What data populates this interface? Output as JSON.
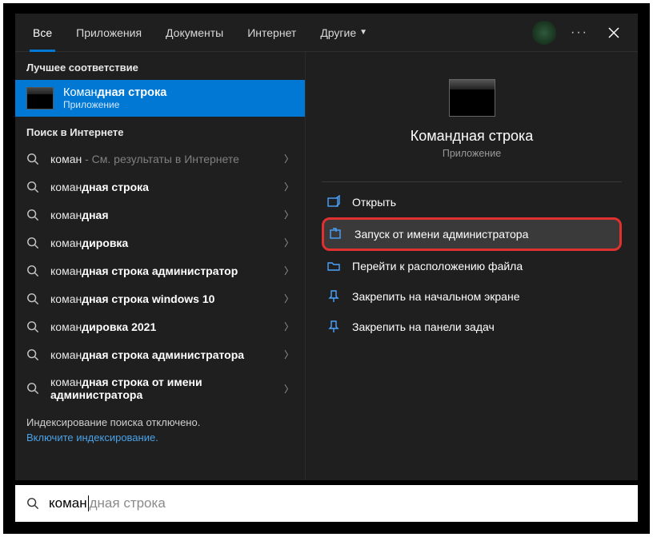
{
  "tabs": {
    "all": "Все",
    "apps": "Приложения",
    "documents": "Документы",
    "internet": "Интернет",
    "other": "Другие"
  },
  "sections": {
    "bestMatch": "Лучшее соответствие",
    "webSearch": "Поиск в Интернете"
  },
  "selected": {
    "prefix": "Коман",
    "bold": "дная строка",
    "subtitle": "Приложение"
  },
  "suggestions": [
    {
      "pre": "коман",
      "gray": " - См. результаты в Интернете",
      "bold": ""
    },
    {
      "pre": "коман",
      "bold": "дная строка"
    },
    {
      "pre": "коман",
      "bold": "дная"
    },
    {
      "pre": "коман",
      "bold": "дировка"
    },
    {
      "pre": "коман",
      "bold": "дная строка администратор"
    },
    {
      "pre": "коман",
      "bold": "дная строка windows 10"
    },
    {
      "pre": "коман",
      "bold": "дировка 2021"
    },
    {
      "pre": "коман",
      "bold": "дная строка администратора"
    },
    {
      "pre": "коман",
      "bold": "дная строка от имени администратора"
    }
  ],
  "indexing": {
    "notice": "Индексирование поиска отключено.",
    "link": "Включите индексирование."
  },
  "preview": {
    "title": "Командная строка",
    "subtitle": "Приложение"
  },
  "actions": {
    "open": "Открыть",
    "runAdmin": "Запуск от имени администратора",
    "fileLocation": "Перейти к расположению файла",
    "pinStart": "Закрепить на начальном экране",
    "pinTaskbar": "Закрепить на панели задач"
  },
  "search": {
    "typed": "коман",
    "ghost": "дная строка"
  }
}
